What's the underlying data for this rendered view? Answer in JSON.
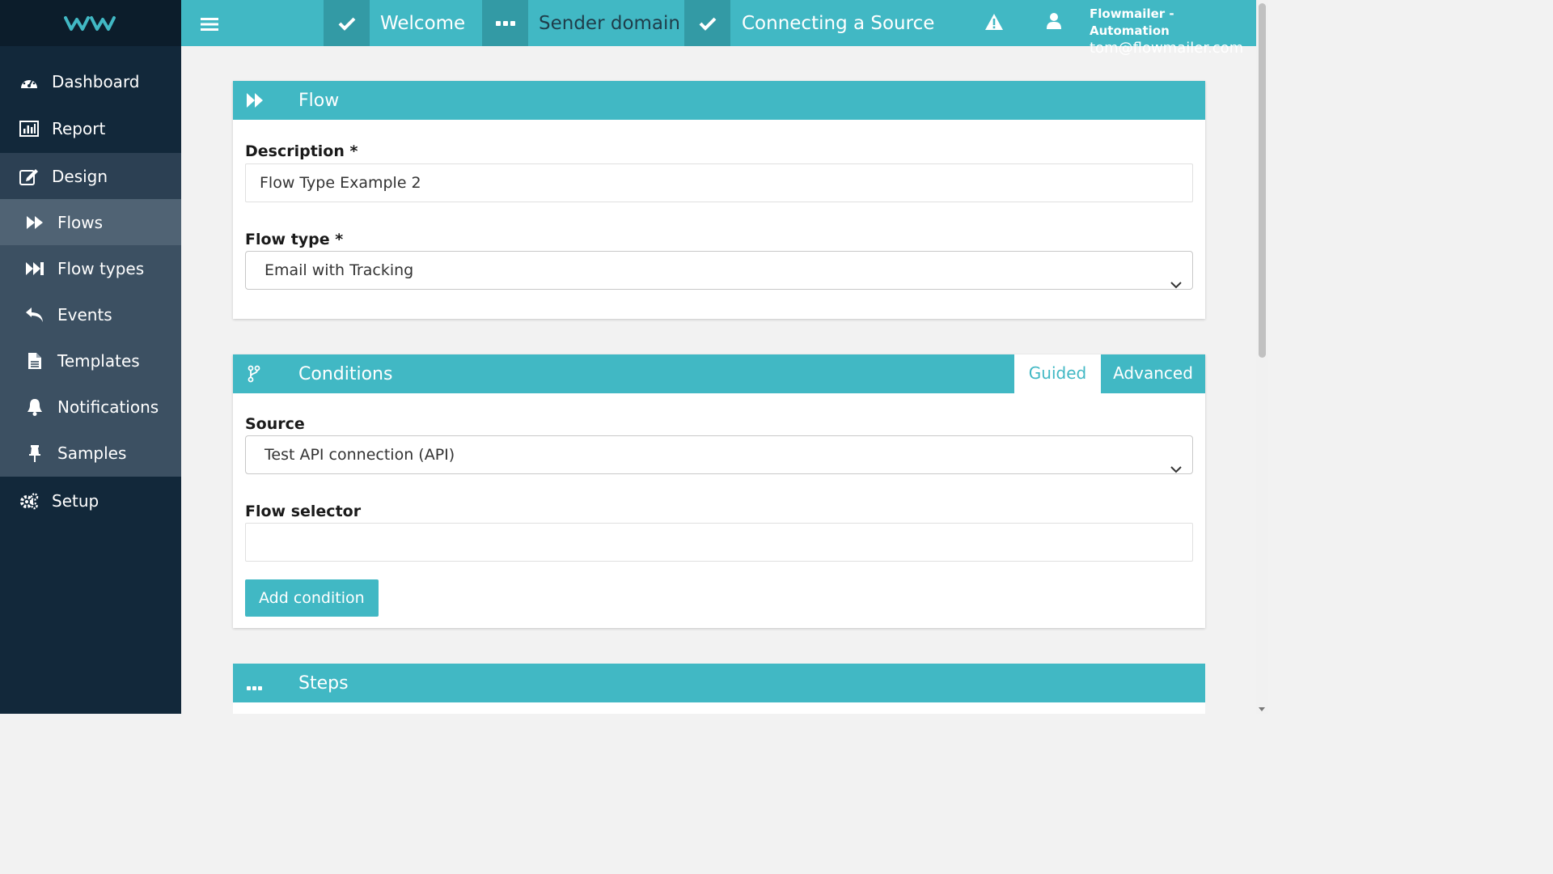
{
  "sidebar": {
    "items": [
      {
        "label": "Dashboard",
        "icon": "dashboard-icon"
      },
      {
        "label": "Report",
        "icon": "report-icon"
      },
      {
        "label": "Design",
        "icon": "design-icon"
      },
      {
        "label": "Flows",
        "icon": "flows-icon"
      },
      {
        "label": "Flow types",
        "icon": "flow-types-icon"
      },
      {
        "label": "Events",
        "icon": "events-icon"
      },
      {
        "label": "Templates",
        "icon": "templates-icon"
      },
      {
        "label": "Notifications",
        "icon": "notifications-icon"
      },
      {
        "label": "Samples",
        "icon": "samples-icon"
      },
      {
        "label": "Setup",
        "icon": "setup-icon"
      }
    ],
    "active": "Flows"
  },
  "topbar": {
    "steps": [
      {
        "label": "Welcome",
        "status": "done"
      },
      {
        "label": "Sender domain",
        "status": "in-progress"
      },
      {
        "label": "Connecting a Source",
        "status": "done"
      }
    ],
    "account_name": "Flowmailer - Automation",
    "account_email": "tom@flowmailer.com"
  },
  "flow_panel": {
    "title": "Flow",
    "description_label": "Description *",
    "description_value": "Flow Type Example 2",
    "flow_type_label": "Flow type *",
    "flow_type_value": "Email with Tracking"
  },
  "conditions_panel": {
    "title": "Conditions",
    "tab_guided": "Guided",
    "tab_advanced": "Advanced",
    "source_label": "Source",
    "source_value": "Test API connection (API)",
    "flow_selector_label": "Flow selector",
    "flow_selector_value": "",
    "add_condition_label": "Add condition"
  },
  "steps_panel": {
    "title": "Steps"
  },
  "colors": {
    "accent": "#41b8c4",
    "accent_dark": "#339aa5",
    "sidebar_bg": "#12283a",
    "sidebar_sub_bg": "#3c5062",
    "sidebar_active_bg": "#506374"
  }
}
